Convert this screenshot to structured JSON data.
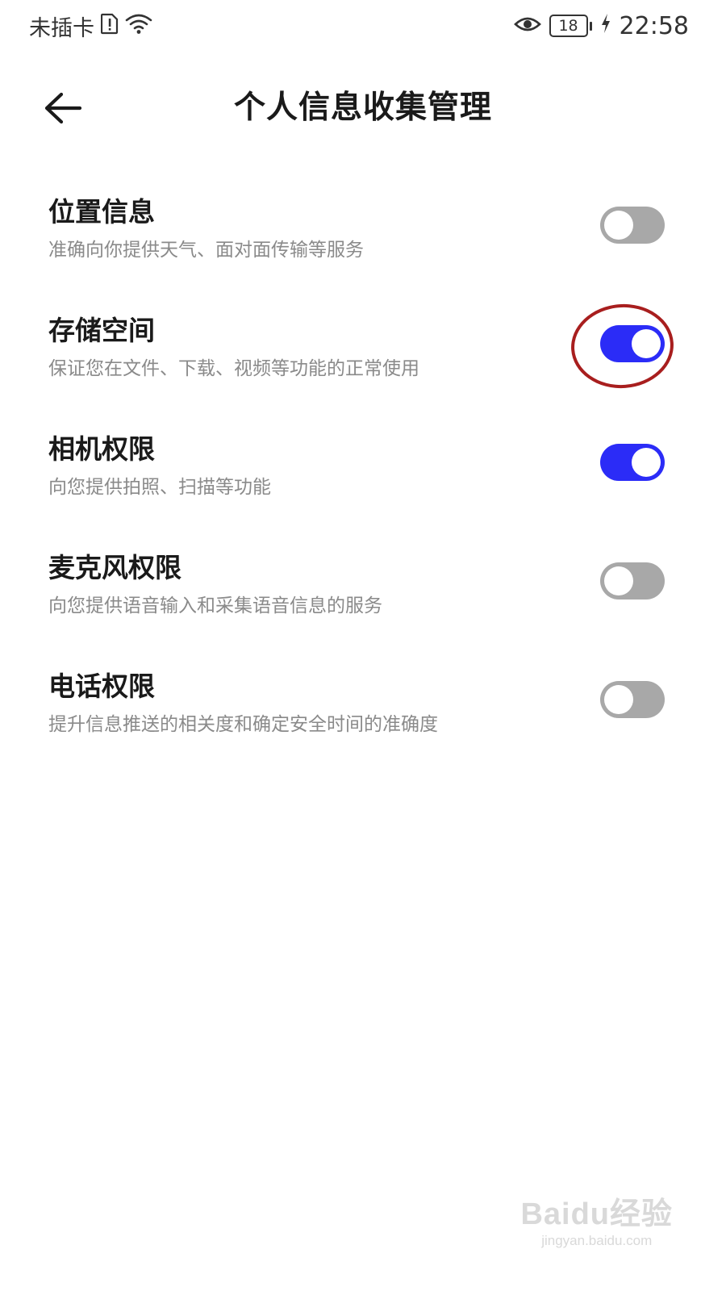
{
  "status_bar": {
    "carrier": "未插卡",
    "battery_level": "18",
    "time": "22:58",
    "icons": [
      "sim-alert-icon",
      "wifi-icon",
      "eye-icon",
      "battery-icon",
      "charging-icon"
    ]
  },
  "header": {
    "title": "个人信息收集管理",
    "back_icon": "back-arrow-icon"
  },
  "settings": [
    {
      "title": "位置信息",
      "desc": "准确向你提供天气、面对面传输等服务",
      "enabled": false
    },
    {
      "title": "存储空间",
      "desc": "保证您在文件、下载、视频等功能的正常使用",
      "enabled": true
    },
    {
      "title": "相机权限",
      "desc": "向您提供拍照、扫描等功能",
      "enabled": true
    },
    {
      "title": "麦克风权限",
      "desc": "向您提供语音输入和采集语音信息的服务",
      "enabled": false
    },
    {
      "title": "电话权限",
      "desc": "提升信息推送的相关度和确定安全时间的准确度",
      "enabled": false
    }
  ],
  "colors": {
    "toggle_on": "#2b2cf7",
    "toggle_off": "#a8a8a8",
    "annotation_circle": "#a81e1e"
  },
  "watermark": {
    "logo": "Baidu经验",
    "url": "jingyan.baidu.com"
  }
}
